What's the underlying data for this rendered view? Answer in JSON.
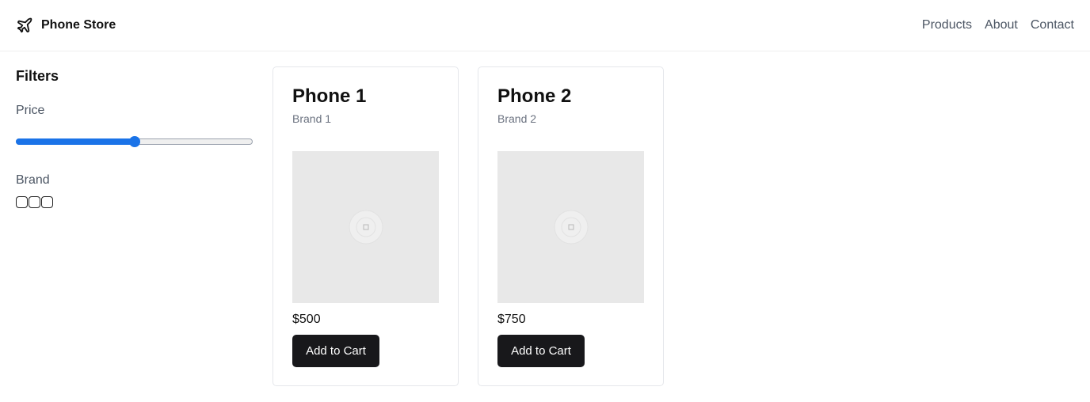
{
  "header": {
    "brand_icon": "plane-icon",
    "brand_name": "Phone Store",
    "nav": [
      "Products",
      "About",
      "Contact"
    ]
  },
  "sidebar": {
    "title": "Filters",
    "price_label": "Price",
    "price_slider_fraction": 0.5,
    "brand_label": "Brand",
    "brand_checkbox_count": 3
  },
  "products": [
    {
      "name": "Phone 1",
      "brand": "Brand 1",
      "image_icon": "broken-image-icon",
      "price": "$500",
      "button": "Add to Cart"
    },
    {
      "name": "Phone 2",
      "brand": "Brand 2",
      "image_icon": "broken-image-icon",
      "price": "$750",
      "button": "Add to Cart"
    }
  ],
  "colors": {
    "accent": "#1a73e8",
    "button": "#18181b",
    "image_placeholder": "#e8e8e8"
  }
}
